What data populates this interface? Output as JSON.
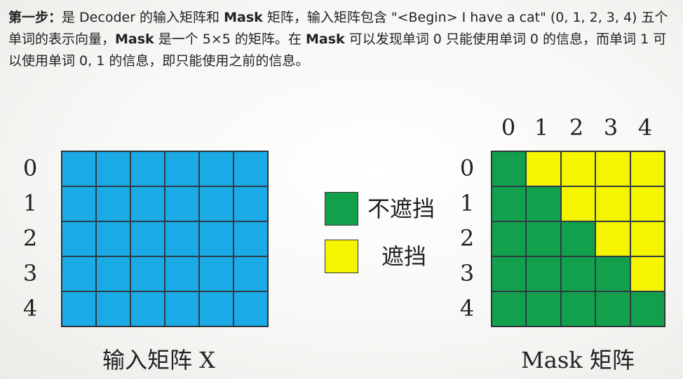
{
  "description": {
    "step_label": "第一步：",
    "t1": "是 Decoder 的输入矩阵和 ",
    "mask_bold_1": "Mask",
    "t2": " 矩阵，输入矩阵包含 \"<Begin> I have a cat\" (0, 1, 2, 3, 4) 五个单词的表示向量，",
    "mask_bold_2": "Mask",
    "t3": " 是一个 5×5 的矩阵。在 ",
    "mask_bold_3": "Mask",
    "t4": " 可以发现单词 0 只能使用单词 0 的信息，而单词 1 可以使用单词 0, 1 的信息，即只能使用之前的信息。"
  },
  "input_matrix": {
    "row_labels": [
      "0",
      "1",
      "2",
      "3",
      "4"
    ],
    "caption": "输入矩阵 X",
    "rows": 5,
    "cols": 6,
    "color": "#1aabe6"
  },
  "legend": {
    "items": [
      {
        "label": "不遮挡",
        "color": "#12a04c"
      },
      {
        "label": "遮挡",
        "color": "#f5f500"
      }
    ]
  },
  "mask_matrix": {
    "col_labels": [
      "0",
      "1",
      "2",
      "3",
      "4"
    ],
    "row_labels": [
      "0",
      "1",
      "2",
      "3",
      "4"
    ],
    "caption": "Mask 矩阵",
    "size": 5,
    "visible_color": "#12a04c",
    "masked_color": "#f5f500"
  }
}
